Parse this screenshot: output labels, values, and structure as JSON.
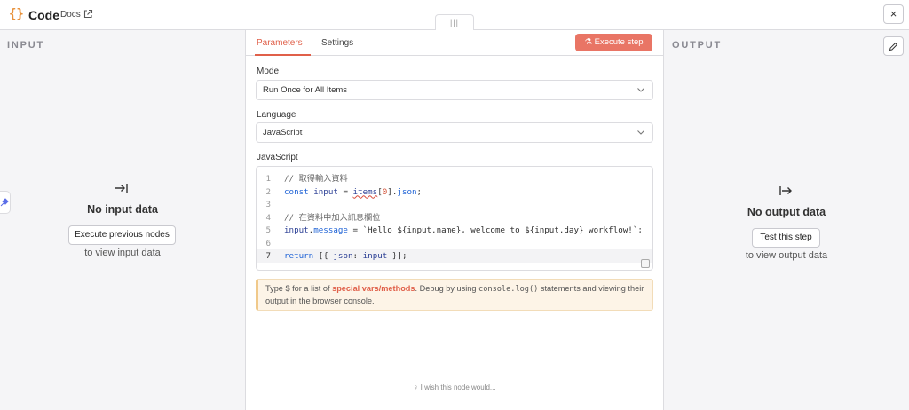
{
  "header": {
    "title": "Code",
    "docs_label": "Docs",
    "close_label": "×"
  },
  "input_pane": {
    "label": "INPUT",
    "icon": "arrow-right-to-bar-icon",
    "empty_title": "No input data",
    "button_label": "Execute previous nodes",
    "sub_text": "to view input data"
  },
  "output_pane": {
    "label": "OUTPUT",
    "icon": "arrow-right-from-bar-icon",
    "empty_title": "No output data",
    "button_label": "Test this step",
    "sub_text": "to view output data"
  },
  "center": {
    "tabs": [
      {
        "label": "Parameters",
        "active": true
      },
      {
        "label": "Settings",
        "active": false
      }
    ],
    "execute_label": "Execute step",
    "mode": {
      "label": "Mode",
      "value": "Run Once for All Items"
    },
    "language": {
      "label": "Language",
      "value": "JavaScript"
    },
    "editor_label": "JavaScript",
    "code_lines": [
      {
        "num": "1",
        "text": "// 取得輸入資料"
      },
      {
        "num": "2",
        "text": "const input = items[0].json;"
      },
      {
        "num": "3",
        "text": ""
      },
      {
        "num": "4",
        "text": "// 在資料中加入訊息欄位"
      },
      {
        "num": "5",
        "text": "input.message = `Hello ${input.name}, welcome to ${input.day} workflow!`;"
      },
      {
        "num": "6",
        "text": ""
      },
      {
        "num": "7",
        "text": "return [{ json: input }];"
      }
    ],
    "hint": {
      "prefix": "Type $ for a list of ",
      "link": "special vars/methods",
      "middle": ". Debug by using ",
      "code": "console.log()",
      "suffix": " statements and viewing their output in the browser console."
    },
    "wish_text": "I wish this node would..."
  },
  "colors": {
    "accent": "#e97565",
    "brace": "#e8913a",
    "hint_bg": "#fdf4e7"
  }
}
